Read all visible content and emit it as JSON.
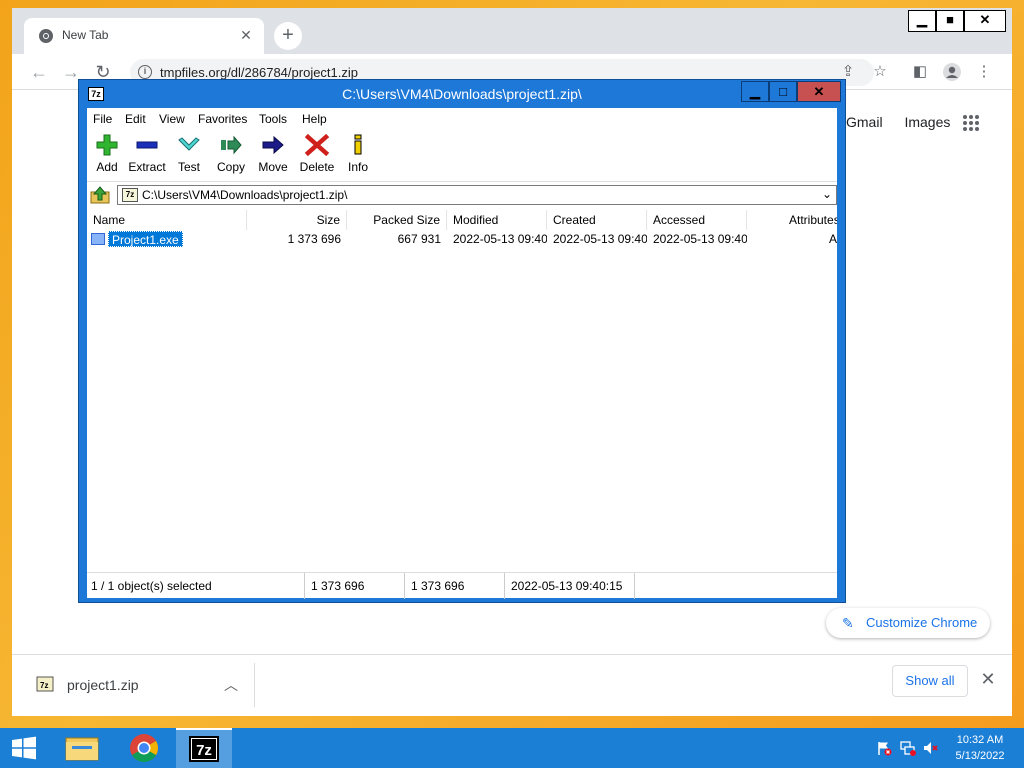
{
  "chrome": {
    "tab_title": "New Tab",
    "tab_close": "✕",
    "new_tab_symbol": "+",
    "url": "tmpfiles.org/dl/286784/project1.zip",
    "ntp_links": [
      "Gmail",
      "Images"
    ],
    "customize_label": "Customize Chrome",
    "window_controls": {
      "minimize": "▁",
      "maximize": "■",
      "close": "✕"
    }
  },
  "downloads": {
    "filename": "project1.zip",
    "show_all_label": "Show all",
    "close_symbol": "✕"
  },
  "sevenzip": {
    "title": "C:\\Users\\VM4\\Downloads\\project1.zip\\",
    "app_icon_text": "7z",
    "window_controls": {
      "minimize": "▁",
      "maximize": "□",
      "close": "✕"
    },
    "menu": [
      "File",
      "Edit",
      "View",
      "Favorites",
      "Tools",
      "Help"
    ],
    "toolbar": [
      "Add",
      "Extract",
      "Test",
      "Copy",
      "Move",
      "Delete",
      "Info"
    ],
    "path": "C:\\Users\\VM4\\Downloads\\project1.zip\\",
    "columns": [
      "Name",
      "Size",
      "Packed Size",
      "Modified",
      "Created",
      "Accessed",
      "Attributes"
    ],
    "rows": [
      {
        "name": "Project1.exe",
        "size": "1 373 696",
        "packed": "667 931",
        "modified": "2022-05-13 09:40",
        "created": "2022-05-13 09:40",
        "accessed": "2022-05-13 09:40",
        "attributes": "A"
      }
    ],
    "status": {
      "selected": "1 / 1 object(s) selected",
      "size": "1 373 696",
      "size2": "1 373 696",
      "modified": "2022-05-13 09:40:15"
    }
  },
  "taskbar": {
    "apps": [
      "file-explorer",
      "google-chrome",
      "7-zip"
    ],
    "active_app": "7-zip",
    "seven_zip_label": "7z",
    "time": "10:32 AM",
    "date": "5/13/2022"
  },
  "colors": {
    "desktop": "#f5a623",
    "taskbar": "#1c7fd6",
    "sevenzip_frame": "#1e78d8",
    "selection": "#0078d7",
    "chrome_accent": "#1a73e8"
  }
}
